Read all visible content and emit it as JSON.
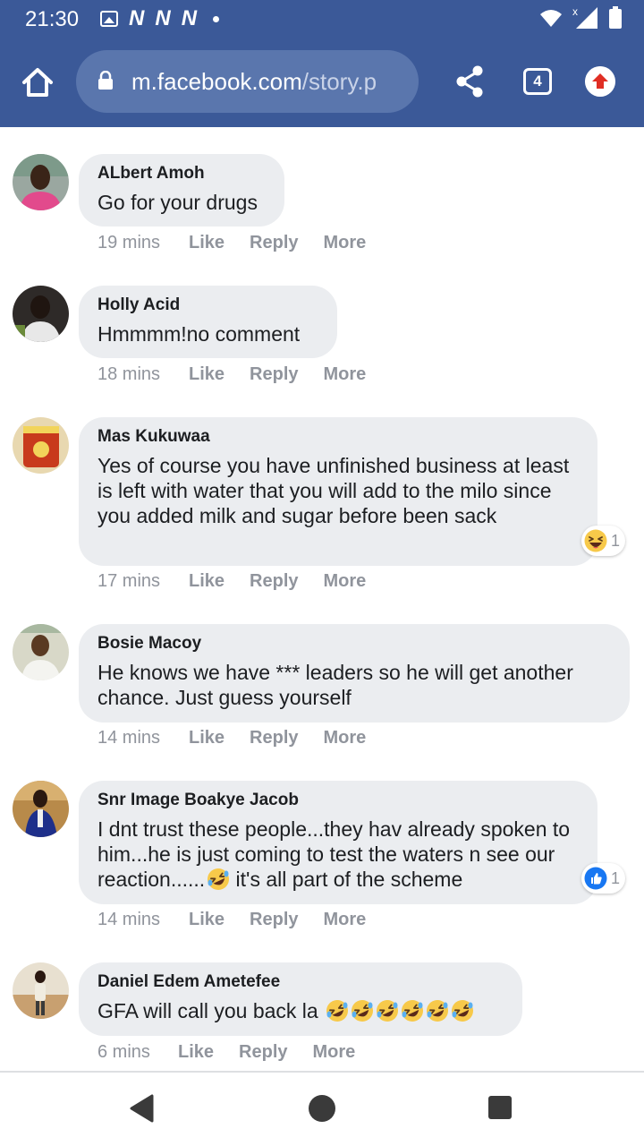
{
  "status_bar": {
    "time": "21:30",
    "left_icons": [
      "image-icon",
      "n-notification-icon",
      "n-notification-icon",
      "n-notification-icon",
      "dot-icon"
    ],
    "notif_letters": [
      "N",
      "N",
      "N"
    ],
    "right_icons": [
      "wifi-icon",
      "signal-no-service-icon",
      "battery-icon"
    ]
  },
  "browser": {
    "url_domain": "m.facebook.com",
    "url_path": "/story.p",
    "tab_count": "4",
    "colors": {
      "bar": "#3b5998",
      "url_pill": "#5a76ad",
      "update_red": "#e02e24"
    }
  },
  "comments": [
    {
      "author": "ALbert Amoh",
      "text": "Go for your drugs",
      "time": "19 mins",
      "like": "Like",
      "reply": "Reply",
      "more": "More"
    },
    {
      "author": "Holly Acid",
      "text": "Hmmmm!no comment",
      "time": "18 mins",
      "like": "Like",
      "reply": "Reply",
      "more": "More"
    },
    {
      "author": "Mas Kukuwaa",
      "text": "Yes of course you have unfinished business at least is left with water that you will add to the milo since you added milk and sugar before been sack",
      "time": "17 mins",
      "like": "Like",
      "reply": "Reply",
      "more": "More",
      "reaction": {
        "icon": "haha-icon",
        "count": "1"
      }
    },
    {
      "author": "Bosie Macoy",
      "text": "He knows we have *** leaders so he will get another chance. Just guess yourself",
      "time": "14 mins",
      "like": "Like",
      "reply": "Reply",
      "more": "More"
    },
    {
      "author": "Snr Image Boakye Jacob",
      "text_before": "I dnt trust these people...they hav already spoken to him...he is just coming to test the waters n see our reaction......",
      "text_after": " it's all part of the scheme",
      "time": "14 mins",
      "like": "Like",
      "reply": "Reply",
      "more": "More",
      "reaction": {
        "icon": "like-icon",
        "count": "1"
      }
    },
    {
      "author": "Daniel Edem Ametefee",
      "text": "GFA will call you back la ",
      "emoji_count": 6,
      "time": "6 mins",
      "like": "Like",
      "reply": "Reply",
      "more": "More"
    }
  ],
  "nav_bar": {
    "buttons": [
      "back-icon",
      "home-icon",
      "recents-icon"
    ]
  }
}
